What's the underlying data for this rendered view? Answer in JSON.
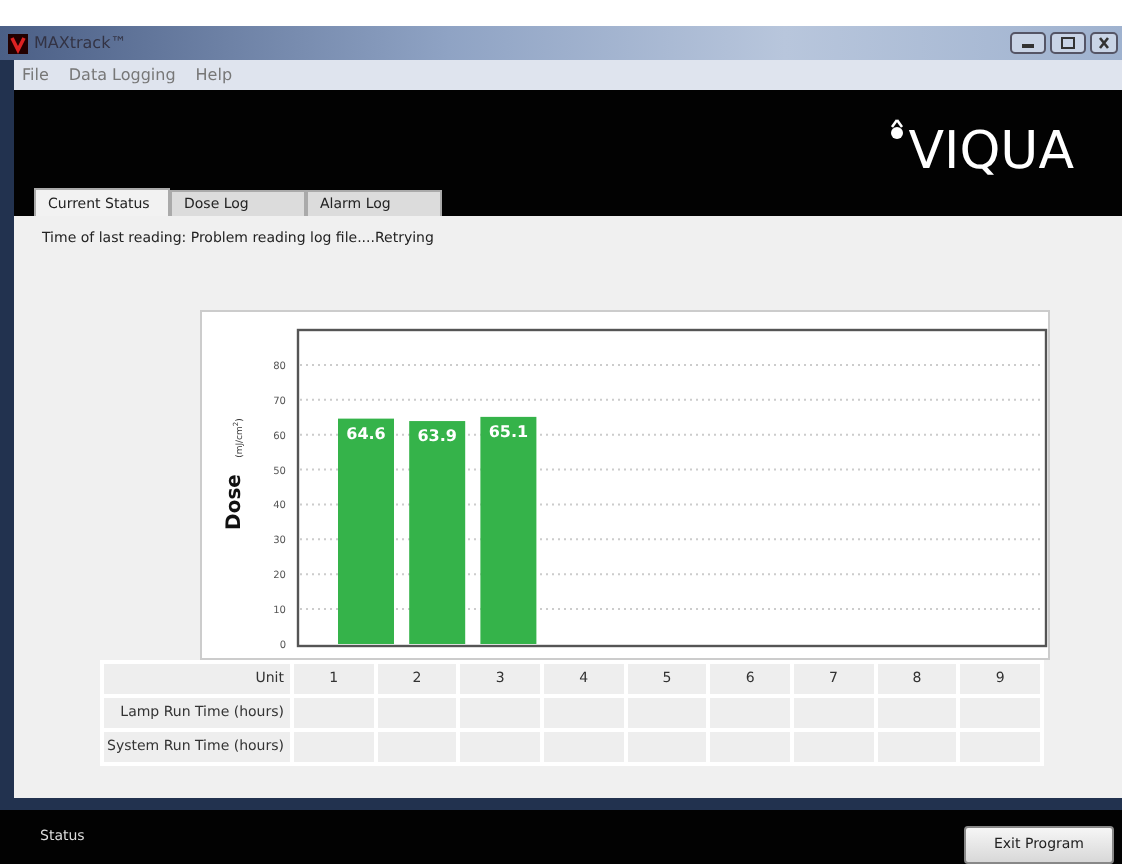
{
  "window": {
    "title": "MAXtrack™"
  },
  "menu": [
    "File",
    "Data Logging",
    "Help"
  ],
  "header": {
    "logo_text": "VIQUA"
  },
  "tabs": [
    {
      "label": "Current Status",
      "selected": true
    },
    {
      "label": "Dose Log",
      "selected": false
    },
    {
      "label": "Alarm Log",
      "selected": false
    }
  ],
  "status_text": "Time of last reading: Problem reading log file....Retrying",
  "chart": {
    "ylabel": "Dose",
    "yunit": "(mJ/cm$^{2}$)",
    "chart_data": {
      "type": "bar",
      "categories": [
        "1",
        "2",
        "3",
        "4",
        "5",
        "6",
        "7",
        "8",
        "9"
      ],
      "values": [
        64.6,
        63.9,
        65.1,
        null,
        null,
        null,
        null,
        null,
        null
      ],
      "ylim": [
        0,
        90
      ],
      "yticks": [
        0,
        10,
        20,
        30,
        40,
        50,
        60,
        70,
        80
      ],
      "grid": true,
      "data_labels": true
    }
  },
  "table": {
    "header": "Unit",
    "rows": [
      {
        "label": "Lamp Run Time (hours)"
      },
      {
        "label": "System Run Time (hours)"
      }
    ]
  },
  "status_bar": {
    "text": "Status",
    "button": "Exit Program"
  }
}
